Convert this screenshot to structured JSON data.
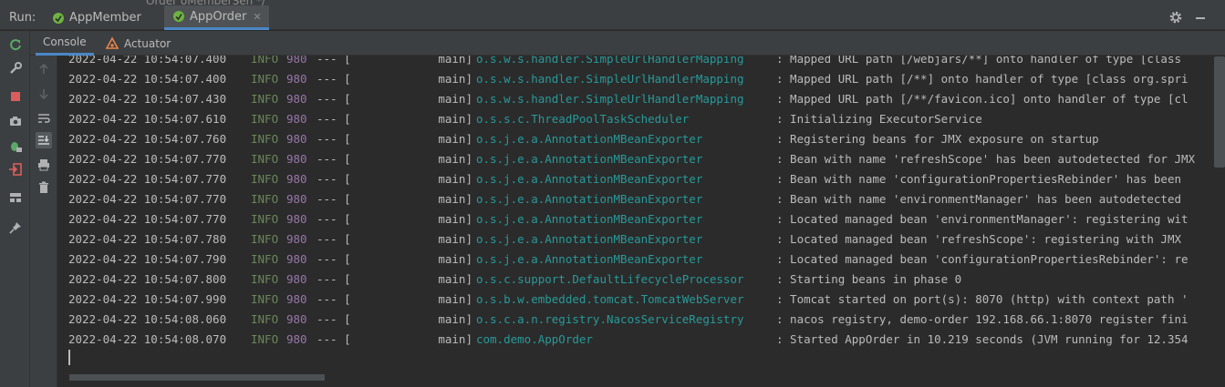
{
  "run_label": "Run:",
  "behind_text": "Order oMemberSen          */",
  "run_tabs": [
    {
      "label": "AppMember",
      "active": false
    },
    {
      "label": "AppOrder",
      "active": true
    }
  ],
  "close_glyph": "✕",
  "sub_tabs": [
    {
      "label": "Console",
      "active": true
    },
    {
      "label": "Actuator",
      "active": false
    }
  ],
  "colors": {
    "level": "#6a8759",
    "pid": "#9876aa",
    "logger": "#299999",
    "accent": "#4a88c7"
  },
  "log_lines": [
    {
      "ts": "2022-04-22 10:54:07.400",
      "level": "INFO",
      "pid": "980",
      "sep": "--- [",
      "thread": "main]",
      "logger": "o.s.w.s.handler.SimpleUrlHandlerMapping",
      "msg": ": Mapped URL path [/webjars/**] onto handler of type [class"
    },
    {
      "ts": "2022-04-22 10:54:07.400",
      "level": "INFO",
      "pid": "980",
      "sep": "--- [",
      "thread": "main]",
      "logger": "o.s.w.s.handler.SimpleUrlHandlerMapping",
      "msg": ": Mapped URL path [/**] onto handler of type [class org.spri"
    },
    {
      "ts": "2022-04-22 10:54:07.430",
      "level": "INFO",
      "pid": "980",
      "sep": "--- [",
      "thread": "main]",
      "logger": "o.s.w.s.handler.SimpleUrlHandlerMapping",
      "msg": ": Mapped URL path [/**/favicon.ico] onto handler of type [cl"
    },
    {
      "ts": "2022-04-22 10:54:07.610",
      "level": "INFO",
      "pid": "980",
      "sep": "--- [",
      "thread": "main]",
      "logger": "o.s.s.c.ThreadPoolTaskScheduler",
      "msg": ": Initializing ExecutorService"
    },
    {
      "ts": "2022-04-22 10:54:07.760",
      "level": "INFO",
      "pid": "980",
      "sep": "--- [",
      "thread": "main]",
      "logger": "o.s.j.e.a.AnnotationMBeanExporter",
      "msg": ": Registering beans for JMX exposure on startup"
    },
    {
      "ts": "2022-04-22 10:54:07.770",
      "level": "INFO",
      "pid": "980",
      "sep": "--- [",
      "thread": "main]",
      "logger": "o.s.j.e.a.AnnotationMBeanExporter",
      "msg": ": Bean with name 'refreshScope' has been autodetected for JMX"
    },
    {
      "ts": "2022-04-22 10:54:07.770",
      "level": "INFO",
      "pid": "980",
      "sep": "--- [",
      "thread": "main]",
      "logger": "o.s.j.e.a.AnnotationMBeanExporter",
      "msg": ": Bean with name 'configurationPropertiesRebinder' has been"
    },
    {
      "ts": "2022-04-22 10:54:07.770",
      "level": "INFO",
      "pid": "980",
      "sep": "--- [",
      "thread": "main]",
      "logger": "o.s.j.e.a.AnnotationMBeanExporter",
      "msg": ": Bean with name 'environmentManager' has been autodetected"
    },
    {
      "ts": "2022-04-22 10:54:07.770",
      "level": "INFO",
      "pid": "980",
      "sep": "--- [",
      "thread": "main]",
      "logger": "o.s.j.e.a.AnnotationMBeanExporter",
      "msg": ": Located managed bean 'environmentManager': registering wit"
    },
    {
      "ts": "2022-04-22 10:54:07.780",
      "level": "INFO",
      "pid": "980",
      "sep": "--- [",
      "thread": "main]",
      "logger": "o.s.j.e.a.AnnotationMBeanExporter",
      "msg": ": Located managed bean 'refreshScope': registering with JMX"
    },
    {
      "ts": "2022-04-22 10:54:07.790",
      "level": "INFO",
      "pid": "980",
      "sep": "--- [",
      "thread": "main]",
      "logger": "o.s.j.e.a.AnnotationMBeanExporter",
      "msg": ": Located managed bean 'configurationPropertiesRebinder': re"
    },
    {
      "ts": "2022-04-22 10:54:07.800",
      "level": "INFO",
      "pid": "980",
      "sep": "--- [",
      "thread": "main]",
      "logger": "o.s.c.support.DefaultLifecycleProcessor",
      "msg": ": Starting beans in phase 0"
    },
    {
      "ts": "2022-04-22 10:54:07.990",
      "level": "INFO",
      "pid": "980",
      "sep": "--- [",
      "thread": "main]",
      "logger": "o.s.b.w.embedded.tomcat.TomcatWebServer",
      "msg": ": Tomcat started on port(s): 8070 (http) with context path '"
    },
    {
      "ts": "2022-04-22 10:54:08.060",
      "level": "INFO",
      "pid": "980",
      "sep": "--- [",
      "thread": "main]",
      "logger": "o.s.c.a.n.registry.NacosServiceRegistry",
      "msg": ": nacos registry, demo-order 192.168.66.1:8070 register fini"
    },
    {
      "ts": "2022-04-22 10:54:08.070",
      "level": "INFO",
      "pid": "980",
      "sep": "--- [",
      "thread": "main]",
      "logger": "com.demo.AppOrder",
      "msg": ": Started AppOrder in 10.219 seconds (JVM running for 12.354"
    }
  ]
}
